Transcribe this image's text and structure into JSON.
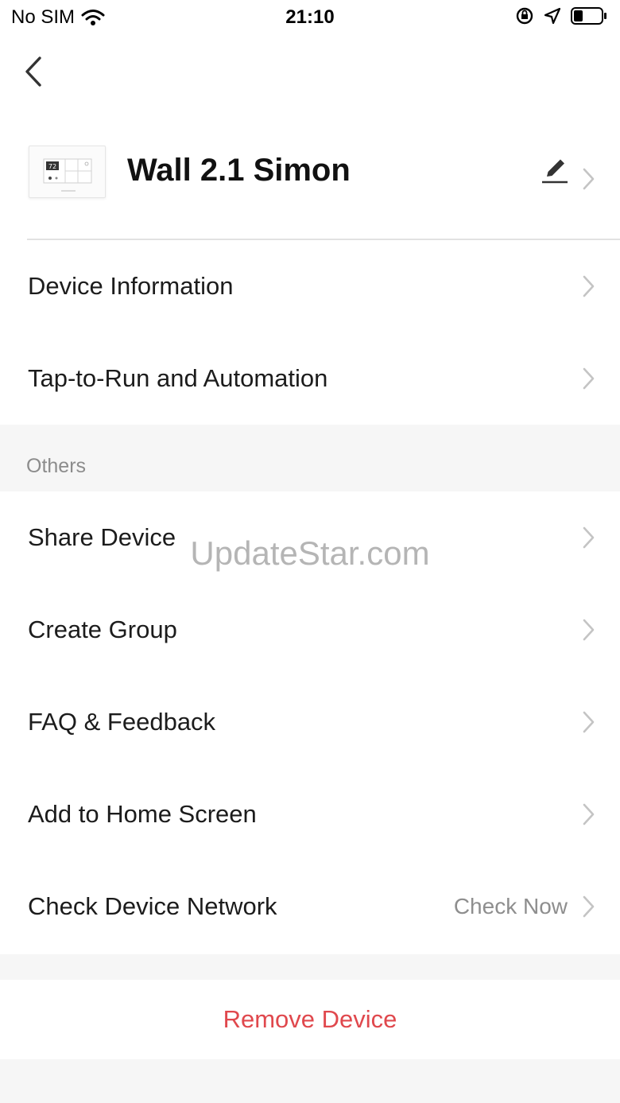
{
  "status_bar": {
    "carrier": "No SIM",
    "time": "21:10"
  },
  "device": {
    "name": "Wall 2.1 Simon",
    "thumbnail_screen_text": "72"
  },
  "menu_top": [
    {
      "label": "Device Information"
    },
    {
      "label": "Tap-to-Run and Automation"
    }
  ],
  "others_header": "Others",
  "menu_others": [
    {
      "label": "Share Device"
    },
    {
      "label": "Create Group"
    },
    {
      "label": "FAQ & Feedback"
    },
    {
      "label": "Add to Home Screen"
    },
    {
      "label": "Check Device Network",
      "value": "Check Now"
    }
  ],
  "remove_label": "Remove Device",
  "watermark": "UpdateStar.com",
  "colors": {
    "danger": "#e0484d",
    "secondary_text": "#8e8e8e",
    "group_background": "#f6f6f6"
  },
  "icons": [
    "wifi-icon",
    "orientation-lock-icon",
    "location-arrow-icon",
    "battery-icon",
    "back-chevron-icon",
    "edit-pencil-icon",
    "chevron-right-icon"
  ]
}
